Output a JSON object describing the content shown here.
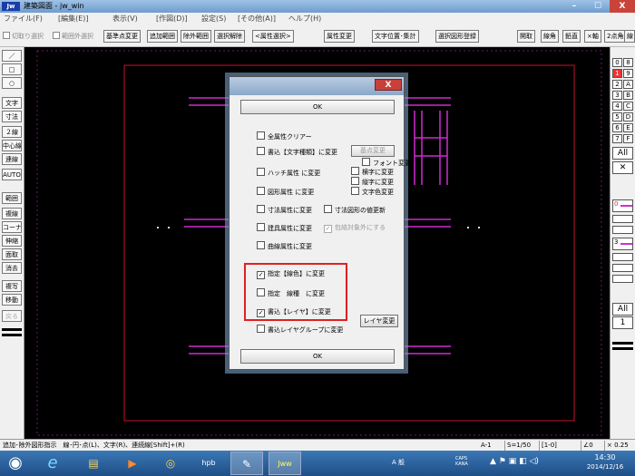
{
  "window": {
    "icon_label": "Jw",
    "title": "建築図面 - jw_win",
    "minimize": "–",
    "maximize": "☐",
    "close": "X"
  },
  "menu": [
    "ファイル(F)",
    "[編集(E)]",
    "表示(V)",
    "[作図(D)]",
    "設定(S)",
    "[その他(A)]",
    "ヘルプ(H)"
  ],
  "toolbar": {
    "cut_select": "切取り選択",
    "range_out_select": "範囲外選択",
    "base_change": "基準点変更",
    "add_range": "追加範囲",
    "remove_range": "除外範囲",
    "deselect": "選択解除",
    "attr_select": "<属性選択>",
    "attr_change": "属性変更",
    "text_pos": "文字位置･集計",
    "select_register": "選択図形登録",
    "right_1": "開取",
    "right_2": "線角",
    "right_3": "鉛直",
    "right_4": "×軸",
    "right_5": "2点角",
    "right_6": "線"
  },
  "left_tools": [
    "／",
    "□",
    "○",
    "文字",
    "寸法",
    "２線",
    "中心線",
    "連線",
    "AUTO",
    "範囲",
    "複線",
    "コーナー",
    "伸縮",
    "面取",
    "消去",
    "複写",
    "移動",
    "戻る"
  ],
  "right_layers": {
    "group_left": [
      "0",
      "1",
      "2",
      "3",
      "4",
      "5",
      "6",
      "7"
    ],
    "group_right": [
      "8",
      "9",
      "A",
      "B",
      "C",
      "D",
      "E",
      "F"
    ],
    "all_label": "All",
    "x_label": "✕",
    "side_markers": [
      "0",
      "3"
    ],
    "all2_label": "All",
    "one_label": "1"
  },
  "dialog": {
    "ok_top": "OK",
    "clear_all": "全属性クリアー",
    "text_type": "書込【文字種類】に変更",
    "base_change": "基点変更",
    "font_change": "フォント変更",
    "horiz_change": "横字に変更",
    "vert_change": "縦字に変更",
    "hatch": "ハッチ属性 に変更",
    "figure": "図形属性 に変更",
    "text_color": "文字色変更",
    "dim_attr": "寸法属性に変更",
    "dim_value": "寸法図形の値更新",
    "fixture": "建具属性に変更",
    "exclude_wrap": "包絡対象外にする",
    "curve": "曲線属性に変更",
    "color_change": "指定【線色】に変更",
    "linetype_change": "指定　線種　に変更",
    "layer_change": "書込【レイヤ】に変更",
    "layer_btn": "レイヤ変更",
    "layer_group": "書込レイヤグループに変更",
    "ok_bottom": "OK",
    "checked_mark": "✓"
  },
  "status": {
    "hint": "追加･除外図形指示　線･円･点(L)、文字(R)、連続線[Shift]+(R)",
    "layer": "A-1",
    "scale": "S=1/50",
    "group": "[1-0]",
    "angle": "∠0",
    "zoom": "× 0.25"
  },
  "taskbar": {
    "start": "◉",
    "ie": "e",
    "explorer": "▤",
    "media": "▶",
    "chrome": "◎",
    "hpb": "hpb",
    "paint": "✎",
    "jww": "Jww",
    "ime": "A 般",
    "caps": "CAPS KANA",
    "time": "14:30",
    "date": "2014/12/16"
  }
}
